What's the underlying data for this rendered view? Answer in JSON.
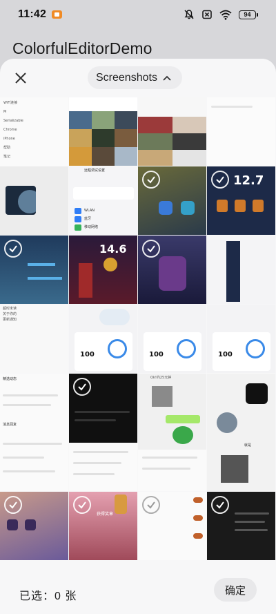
{
  "status_bar": {
    "time": "11:42",
    "battery_level": "94",
    "icons": [
      "app-notification-icon",
      "mute-icon",
      "sim-off-icon",
      "wifi-icon",
      "battery-icon"
    ]
  },
  "app": {
    "title": "ColorfulEditorDemo"
  },
  "picker": {
    "album_label": "Screenshots",
    "close_icon": "close-icon",
    "album_icon": "chevron-up-icon"
  },
  "grid": {
    "thumbnails": [
      {
        "label": "doc-list",
        "texts": [
          "WiFi连接",
          "M",
          "Serializable",
          "Chrome",
          "iPhone",
          "帮助",
          "笔记"
        ]
      },
      {
        "label": "photo-collage-1"
      },
      {
        "label": "photo-collage-2"
      },
      {
        "label": "blank-doc"
      },
      {
        "label": "moon-wallpaper"
      },
      {
        "label": "settings-screen",
        "texts": [
          "远程调试设置",
          "WLAN",
          "蓝牙",
          "移动网络"
        ]
      },
      {
        "label": "game-lobby-1",
        "selectable": true
      },
      {
        "label": "game-rank",
        "selectable": true,
        "number": "12.7"
      },
      {
        "label": "game-stats",
        "selectable": true
      },
      {
        "label": "game-score",
        "number": "14.6"
      },
      {
        "label": "game-hero",
        "selectable": true
      },
      {
        "label": "blank-doc-2"
      },
      {
        "label": "chat-list",
        "texts": [
          "超时未读",
          "关于你的",
          "更新通知"
        ]
      },
      {
        "label": "score-card-1",
        "number": "100"
      },
      {
        "label": "score-card-2",
        "number": "100"
      },
      {
        "label": "score-card-3",
        "number": "100"
      },
      {
        "label": "forum-post",
        "texts": [
          "精选动态",
          "消息回复"
        ]
      },
      {
        "label": "dark-terminal",
        "selectable": true
      },
      {
        "label": "chat-sticker",
        "texts": [
          "Ok!约25元钟"
        ]
      },
      {
        "label": "chat-meme",
        "texts": [
          "就是"
        ]
      },
      {
        "label": "purple-game",
        "selectable": true
      },
      {
        "label": "red-card",
        "selectable": true,
        "texts": [
          "获得奖章"
        ]
      },
      {
        "label": "settings-toggles",
        "selectable": true
      },
      {
        "label": "code-screen",
        "selectable": true
      }
    ]
  },
  "footer": {
    "selected_label": "已选：0 张",
    "confirm_label": "确定"
  }
}
